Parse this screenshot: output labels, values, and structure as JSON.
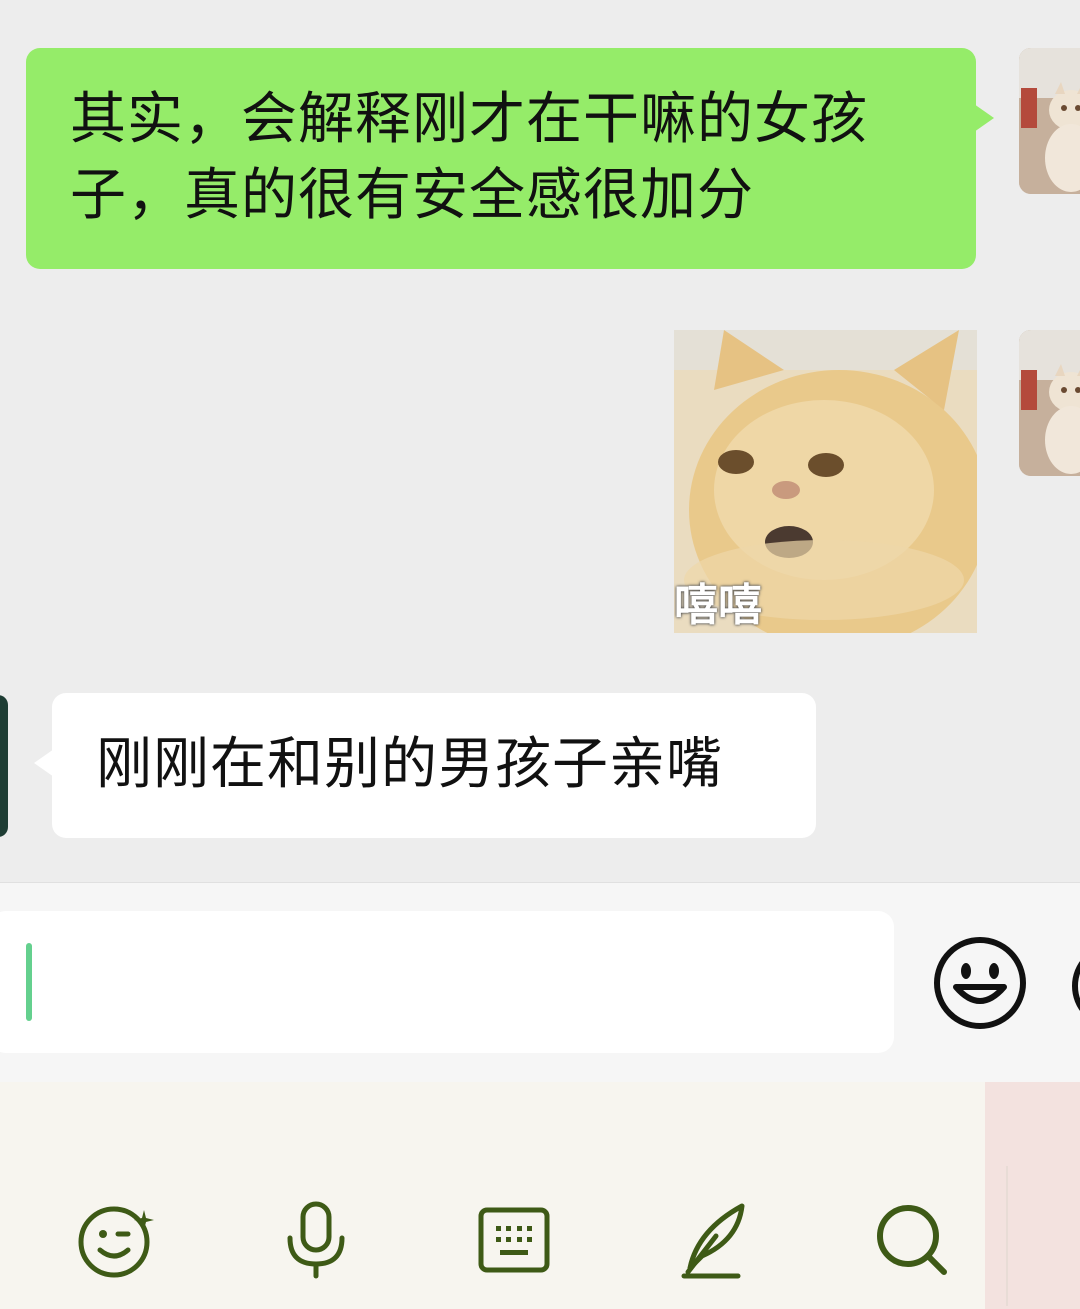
{
  "messages": [
    {
      "side": "out",
      "text": "其实，会解释刚才在干嘛的女孩子，真的很有安全感很加分"
    },
    {
      "side": "out",
      "type": "sticker",
      "caption": "嘻嘻"
    },
    {
      "side": "in",
      "text": "刚刚在和别的男孩子亲嘴"
    }
  ],
  "input": {
    "value": "",
    "placeholder": ""
  },
  "icons": {
    "emoji_button": "smile-icon",
    "more_button": "plus-circle-icon",
    "toolbar": [
      "wink-emoji-icon",
      "microphone-icon",
      "keyboard-icon",
      "feather-pen-icon",
      "search-icon"
    ]
  },
  "colors": {
    "outgoing_bubble": "#95ec69",
    "incoming_bubble": "#ffffff",
    "chat_background": "#ededed",
    "toolbar_icon": "#3e5a16",
    "cursor": "#64d08e"
  }
}
